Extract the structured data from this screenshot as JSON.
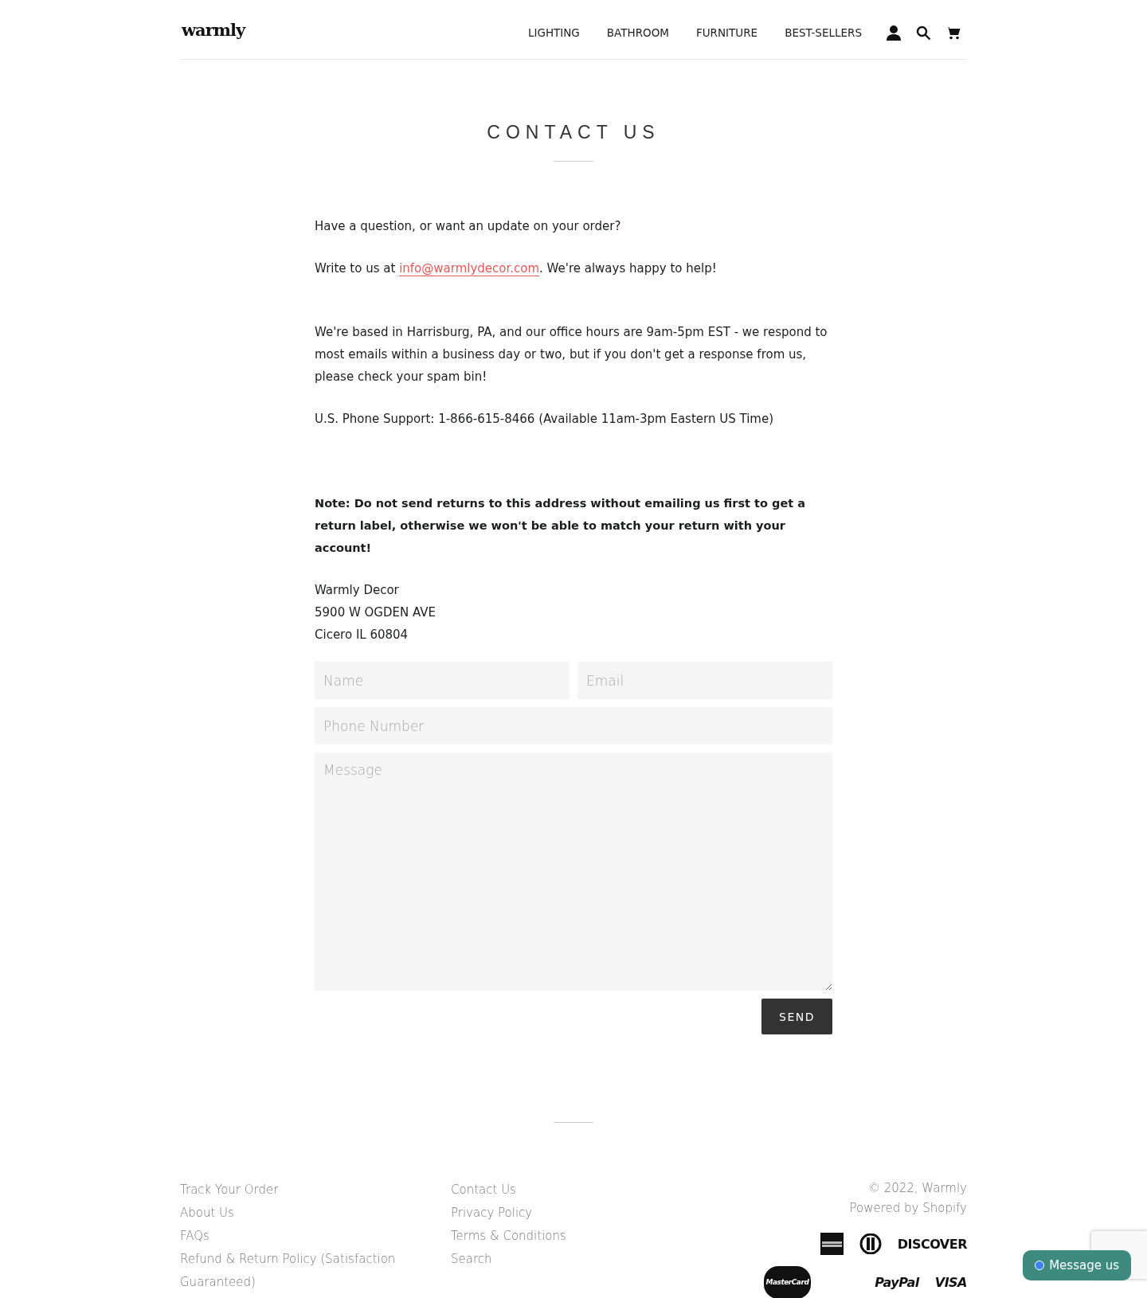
{
  "header": {
    "logo": "warmly",
    "nav": [
      {
        "label": "LIGHTING"
      },
      {
        "label": "BATHROOM"
      },
      {
        "label": "FURNITURE"
      },
      {
        "label": "BEST-SELLERS"
      }
    ]
  },
  "page": {
    "title": "CONTACT US",
    "paragraphs": [
      {
        "kind": "text",
        "text": "Have a question, or want an update on your order?"
      },
      {
        "kind": "email",
        "before": "Write to us at ",
        "link": "info@warmlydecor.com",
        "after": ". We're always happy to help!"
      },
      {
        "kind": "text",
        "text": "We're based in Harrisburg, PA, and our office hours are 9am-5pm EST - we respond to most emails within a business day or two, but if you don't get a response from us, please check your spam bin!"
      },
      {
        "kind": "text",
        "text": "U.S. Phone Support: 1-866-615-8466 (Available 11am-3pm Eastern US Time)"
      },
      {
        "kind": "note",
        "text": "Note: Do not send returns to this address without emailing us first to get a return label, otherwise we won't be able to match your return with your account!"
      }
    ],
    "address": [
      "Warmly Decor",
      "5900 W OGDEN AVE",
      "Cicero IL 60804"
    ]
  },
  "form": {
    "name": {
      "placeholder": "Name"
    },
    "email": {
      "placeholder": "Email"
    },
    "phone": {
      "placeholder": "Phone Number"
    },
    "message": {
      "placeholder": "Message"
    },
    "submit": "SEND"
  },
  "footer": {
    "column_1": [
      "Track Your Order",
      "About Us",
      "FAQs",
      "Refund & Return Policy (Satisfaction Guaranteed)"
    ],
    "column_2": [
      "Contact Us",
      "Privacy Policy",
      "Terms & Conditions",
      "Search"
    ],
    "copyright": "© 2022, Warmly",
    "powered": "Powered by Shopify",
    "payment_icons": [
      {
        "kind": "amex"
      },
      {
        "kind": "diners"
      },
      {
        "kind": "discover",
        "label": "DISCOVER"
      },
      {
        "kind": "mastercard",
        "label": "MasterCard"
      },
      {
        "kind": "paypal",
        "label": "PayPal"
      },
      {
        "kind": "visa",
        "label": "VISA"
      }
    ]
  },
  "chat": {
    "label": "Message us"
  }
}
